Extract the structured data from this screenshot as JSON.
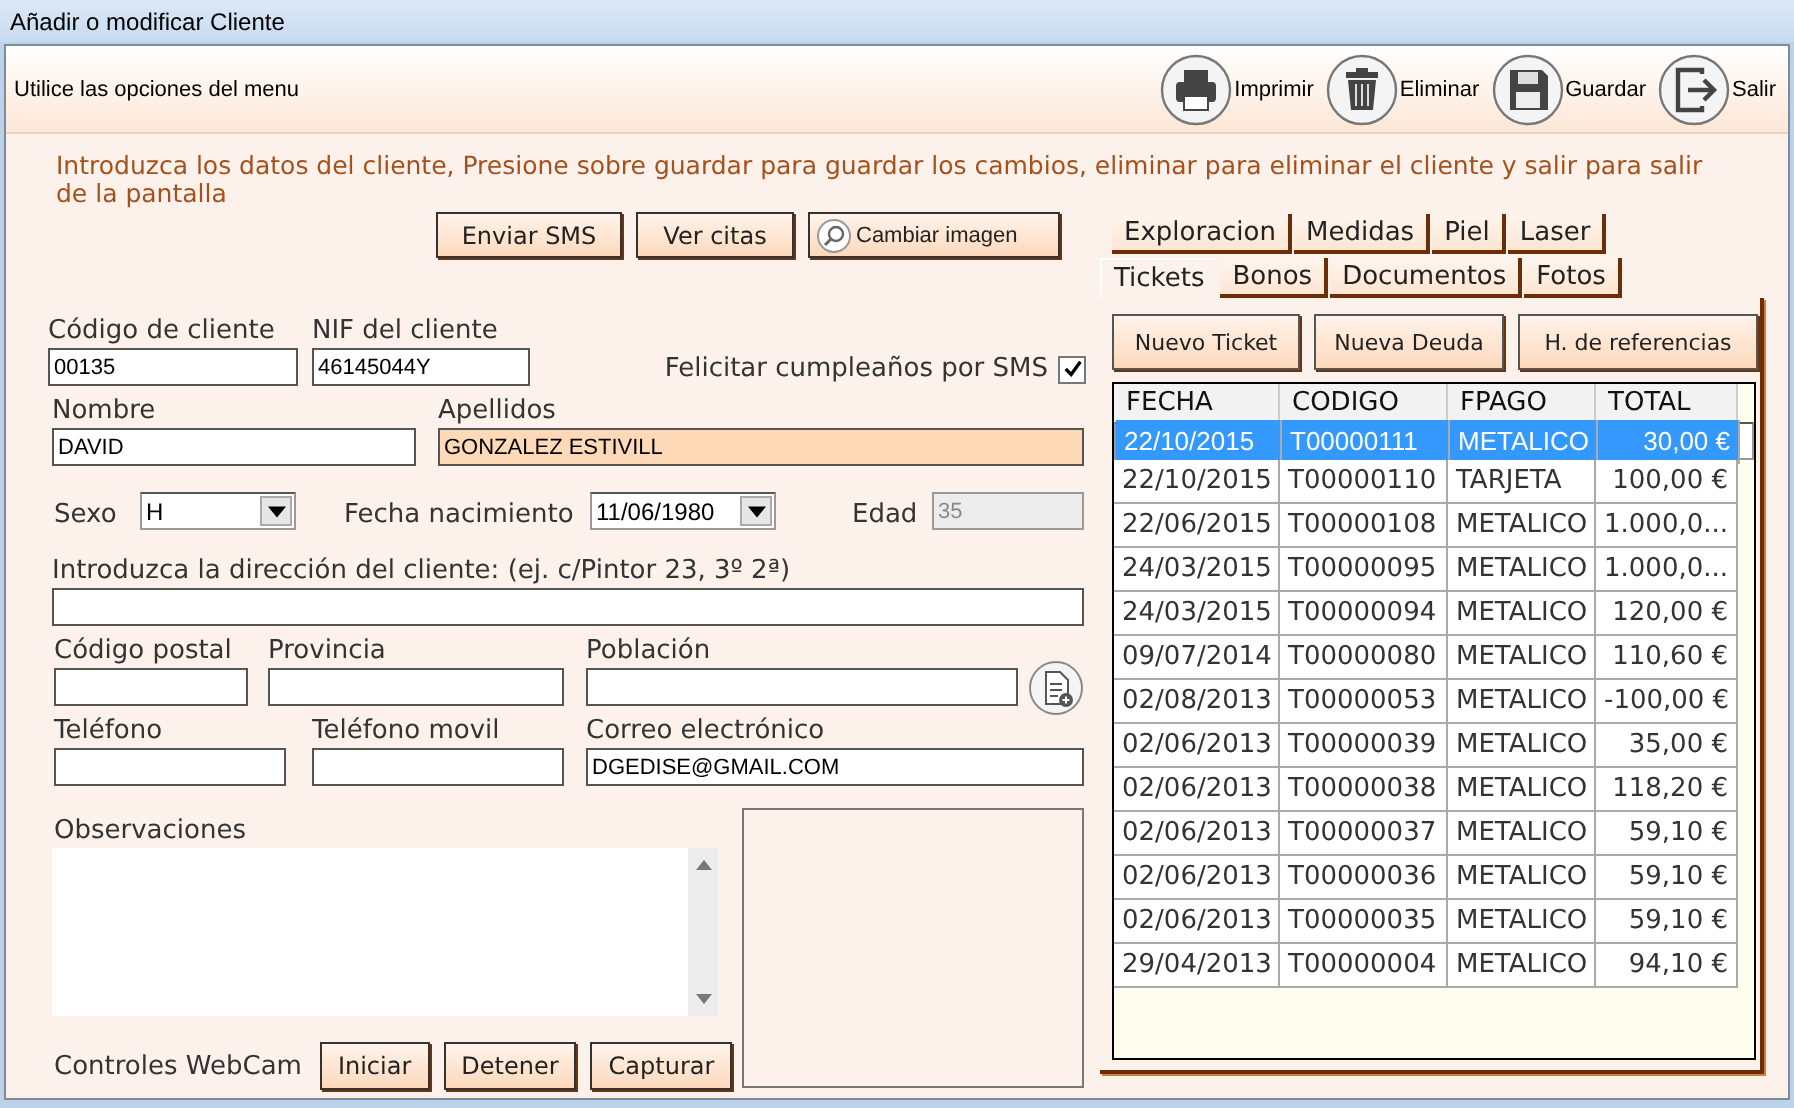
{
  "window": {
    "title": "Añadir o modificar Cliente"
  },
  "menu_bar": {
    "message": "Utilice las opciones del menu",
    "actions": [
      {
        "kind": "print",
        "label": "Imprimir"
      },
      {
        "kind": "delete",
        "label": "Eliminar"
      },
      {
        "kind": "save",
        "label": "Guardar"
      },
      {
        "kind": "exit",
        "label": "Salir"
      }
    ]
  },
  "instructions": "Introduzca los datos del cliente, Presione sobre guardar para guardar los cambios, eliminar para eliminar el cliente y salir para salir de la pantalla",
  "action_buttons": [
    {
      "kind": "plain",
      "label": "Enviar SMS"
    },
    {
      "kind": "plain",
      "label": "Ver citas"
    },
    {
      "kind": "search",
      "label": "Cambiar imagen"
    }
  ],
  "form": {
    "client_code": {
      "label": "Código de cliente",
      "value": "00135"
    },
    "nif": {
      "label": "NIF del cliente",
      "value": "46145044Y"
    },
    "sms_birthday": {
      "label": "Felicitar cumpleaños por SMS",
      "checked": true
    },
    "name": {
      "label": "Nombre",
      "value": "DAVID"
    },
    "surname": {
      "label": "Apellidos",
      "value": "GONZALEZ ESTIVILL",
      "focused": true
    },
    "sex": {
      "label": "Sexo",
      "value": "H"
    },
    "birth_date": {
      "label": "Fecha nacimiento",
      "value": "11/06/1980"
    },
    "age": {
      "label": "Edad",
      "value": "35",
      "disabled": true
    },
    "address": {
      "label": "Introduzca la dirección del cliente: (ej. c/Pintor 23, 3º 2ª)"
    },
    "postal_code": {
      "label": "Código postal"
    },
    "province": {
      "label": "Provincia"
    },
    "town": {
      "label": "Población"
    },
    "phone": {
      "label": "Teléfono"
    },
    "mobile": {
      "label": "Teléfono movil"
    },
    "email": {
      "label": "Correo electrónico",
      "value": "DGEDISE@GMAIL.COM"
    },
    "notes": {
      "label": "Observaciones"
    }
  },
  "webcam": {
    "label": "Controles WebCam",
    "buttons": [
      "Iniciar",
      "Detener",
      "Capturar"
    ]
  },
  "tab_rows": [
    {
      "tabs": [
        {
          "label": "Exploracion",
          "selected": false
        },
        {
          "label": "Medidas",
          "selected": false
        },
        {
          "label": "Piel",
          "selected": false
        },
        {
          "label": "Laser",
          "selected": false
        }
      ]
    },
    {
      "tabs": [
        {
          "label": "Tickets",
          "selected": true
        },
        {
          "label": "Bonos",
          "selected": false
        },
        {
          "label": "Documentos",
          "selected": false
        },
        {
          "label": "Fotos",
          "selected": false
        }
      ]
    }
  ],
  "ticket_buttons": [
    "Nuevo Ticket",
    "Nueva Deuda",
    "H. de referencias"
  ],
  "table": {
    "columns": [
      "FECHA",
      "CODIGO",
      "FPAGO",
      "TOTAL"
    ],
    "rows": [
      {
        "cells": [
          "22/10/2015",
          "T00000111",
          "METALICO",
          "30,00 €"
        ],
        "selected": true
      },
      {
        "cells": [
          "22/10/2015",
          "T00000110",
          "TARJETA",
          "100,00 €"
        ],
        "selected": false
      },
      {
        "cells": [
          "22/06/2015",
          "T00000108",
          "METALICO",
          "1.000,0..."
        ],
        "selected": false
      },
      {
        "cells": [
          "24/03/2015",
          "T00000095",
          "METALICO",
          "1.000,0..."
        ],
        "selected": false
      },
      {
        "cells": [
          "24/03/2015",
          "T00000094",
          "METALICO",
          "120,00 €"
        ],
        "selected": false
      },
      {
        "cells": [
          "09/07/2014",
          "T00000080",
          "METALICO",
          "110,60 €"
        ],
        "selected": false
      },
      {
        "cells": [
          "02/08/2013",
          "T00000053",
          "METALICO",
          "-100,00 €"
        ],
        "selected": false
      },
      {
        "cells": [
          "02/06/2013",
          "T00000039",
          "METALICO",
          "35,00 €"
        ],
        "selected": false
      },
      {
        "cells": [
          "02/06/2013",
          "T00000038",
          "METALICO",
          "118,20 €"
        ],
        "selected": false
      },
      {
        "cells": [
          "02/06/2013",
          "T00000037",
          "METALICO",
          "59,10 €"
        ],
        "selected": false
      },
      {
        "cells": [
          "02/06/2013",
          "T00000036",
          "METALICO",
          "59,10 €"
        ],
        "selected": false
      },
      {
        "cells": [
          "02/06/2013",
          "T00000035",
          "METALICO",
          "59,10 €"
        ],
        "selected": false
      },
      {
        "cells": [
          "29/04/2013",
          "T00000004",
          "METALICO",
          "94,10 €"
        ],
        "selected": false
      }
    ]
  }
}
